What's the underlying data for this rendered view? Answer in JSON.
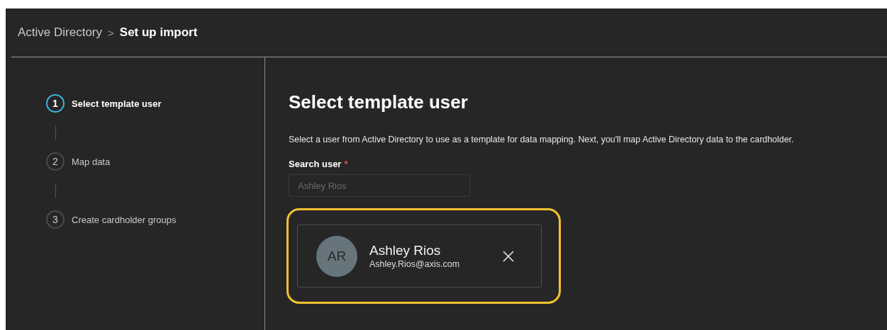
{
  "breadcrumb": {
    "parent": "Active Directory",
    "separator": ">",
    "current": "Set up import"
  },
  "steps": [
    {
      "number": "1",
      "label": "Select template user",
      "selected": true
    },
    {
      "number": "2",
      "label": "Map data",
      "selected": false
    },
    {
      "number": "3",
      "label": "Create cardholder groups",
      "selected": false
    }
  ],
  "main": {
    "title": "Select template user",
    "description": "Select a user from Active Directory to use as a template for data mapping. Next, you'll map Active Directory data to the cardholder.",
    "search": {
      "label": "Search user",
      "required_mark": "*",
      "placeholder": "Ashley Rios"
    },
    "selected_user": {
      "initials": "AR",
      "name": "Ashley Rios",
      "email": "Ashley.Rios@axis.com",
      "highlighted": true
    }
  }
}
